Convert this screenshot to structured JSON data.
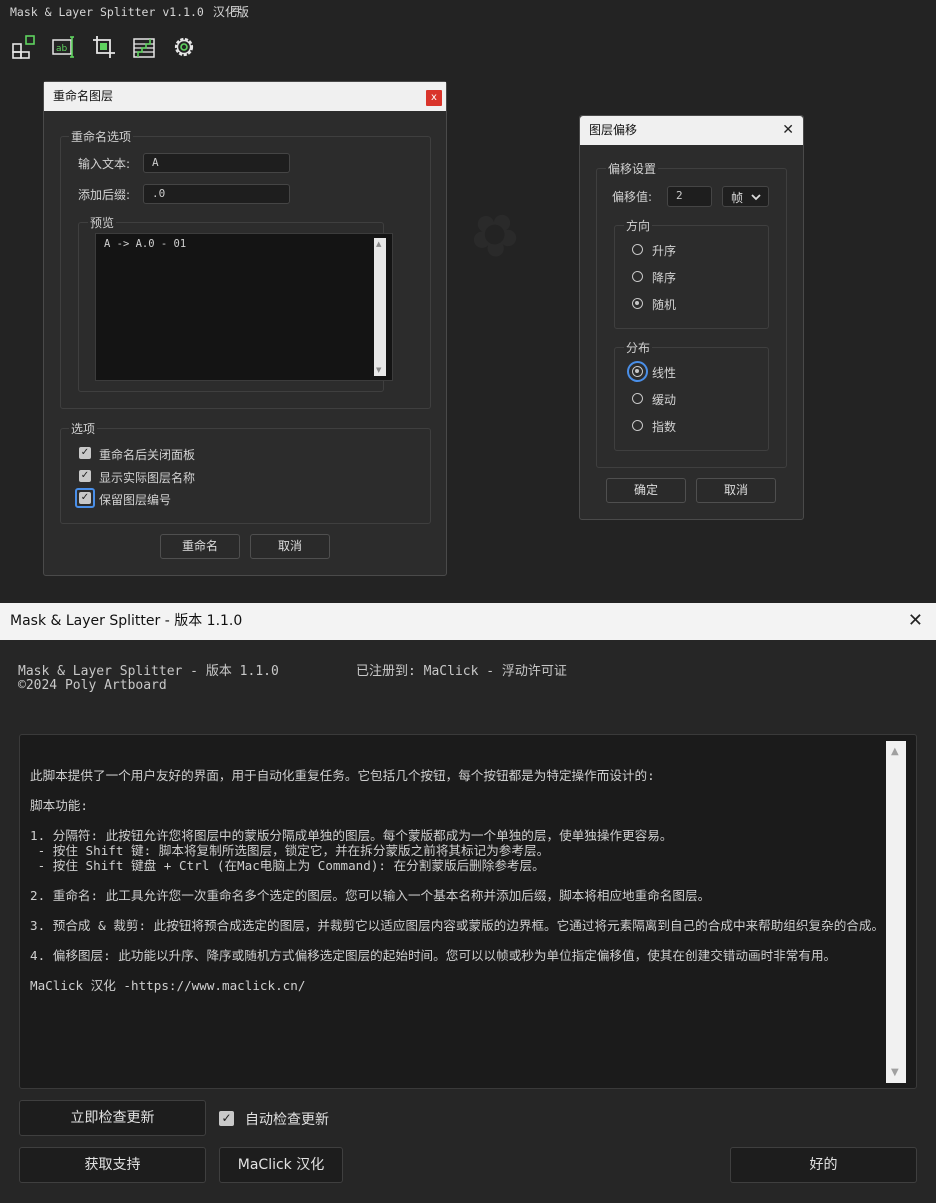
{
  "app": {
    "title": "Mask & Layer Splitter v1.1.0",
    "title_suffix": "汉化版",
    "menu_glyph": "≡",
    "toolbar_icons": [
      "split-mask-icon",
      "rename-layer-icon",
      "precompose-crop-icon",
      "offset-layers-icon",
      "settings-gear-icon"
    ],
    "icon_color": "#5fd35f"
  },
  "rename_dialog": {
    "title": "重命名图层",
    "close_label": "x",
    "options_group": "重命名选项",
    "input_label": "输入文本:",
    "input_value": "A",
    "suffix_label": "添加后缀:",
    "suffix_value": ".0",
    "preview_group": "预览",
    "preview_text": "A -> A.0 - 01",
    "settings_group": "选项",
    "checkboxes": [
      {
        "label": "重命名后关闭面板",
        "checked": true
      },
      {
        "label": "显示实际图层名称",
        "checked": true
      },
      {
        "label": "保留图层编号",
        "checked": true
      }
    ],
    "rename_button": "重命名",
    "cancel_button": "取消"
  },
  "offset_dialog": {
    "title": "图层偏移",
    "close_label": "✕",
    "settings_group": "偏移设置",
    "offset_label": "偏移值:",
    "offset_value": "2",
    "unit_value": "帧",
    "direction_group": "方向",
    "direction_options": [
      {
        "label": "升序",
        "selected": false
      },
      {
        "label": "降序",
        "selected": false
      },
      {
        "label": "随机",
        "selected": true
      }
    ],
    "distribution_group": "分布",
    "distribution_options": [
      {
        "label": "线性",
        "selected": true
      },
      {
        "label": "缓动",
        "selected": false
      },
      {
        "label": "指数",
        "selected": false
      }
    ],
    "ok_button": "确定",
    "cancel_button": "取消"
  },
  "about_window": {
    "title": "Mask & Layer Splitter - 版本 1.1.0",
    "close_label": "✕",
    "product_line": "Mask & Layer Splitter - 版本 1.1.0",
    "copyright": "©2024 Poly Artboard",
    "registration": "已注册到: MaClick - 浮动许可证",
    "description_lines": [
      "此脚本提供了一个用户友好的界面，用于自动化重复任务。它包括几个按钮，每个按钮都是为特定操作而设计的:",
      "",
      "脚本功能:",
      "",
      "1. 分隔符: 此按钮允许您将图层中的蒙版分隔成单独的图层。每个蒙版都成为一个单独的层，使单独操作更容易。",
      " - 按住 Shift 键: 脚本将复制所选图层，锁定它，并在拆分蒙版之前将其标记为参考层。",
      " - 按住 Shift 键盘 + Ctrl (在Mac电脑上为 Command): 在分割蒙版后删除参考层。",
      "",
      "2. 重命名: 此工具允许您一次重命名多个选定的图层。您可以输入一个基本名称并添加后缀，脚本将相应地重命名图层。",
      "",
      "3. 预合成 & 裁剪: 此按钮将预合成选定的图层，并裁剪它以适应图层内容或蒙版的边界框。它通过将元素隔离到自己的合成中来帮助组织复杂的合成。",
      "",
      "4. 偏移图层: 此功能以升序、降序或随机方式偏移选定图层的起始时间。您可以以帧或秒为单位指定偏移值，使其在创建交错动画时非常有用。",
      "",
      "MaClick 汉化 -https://www.maclick.cn/"
    ],
    "check_update_button": "立即检查更新",
    "auto_check_label": "自动检查更新",
    "auto_check_checked": true,
    "support_button": "获取支持",
    "maclick_button": "MaClick 汉化",
    "ok_button": "好的"
  }
}
